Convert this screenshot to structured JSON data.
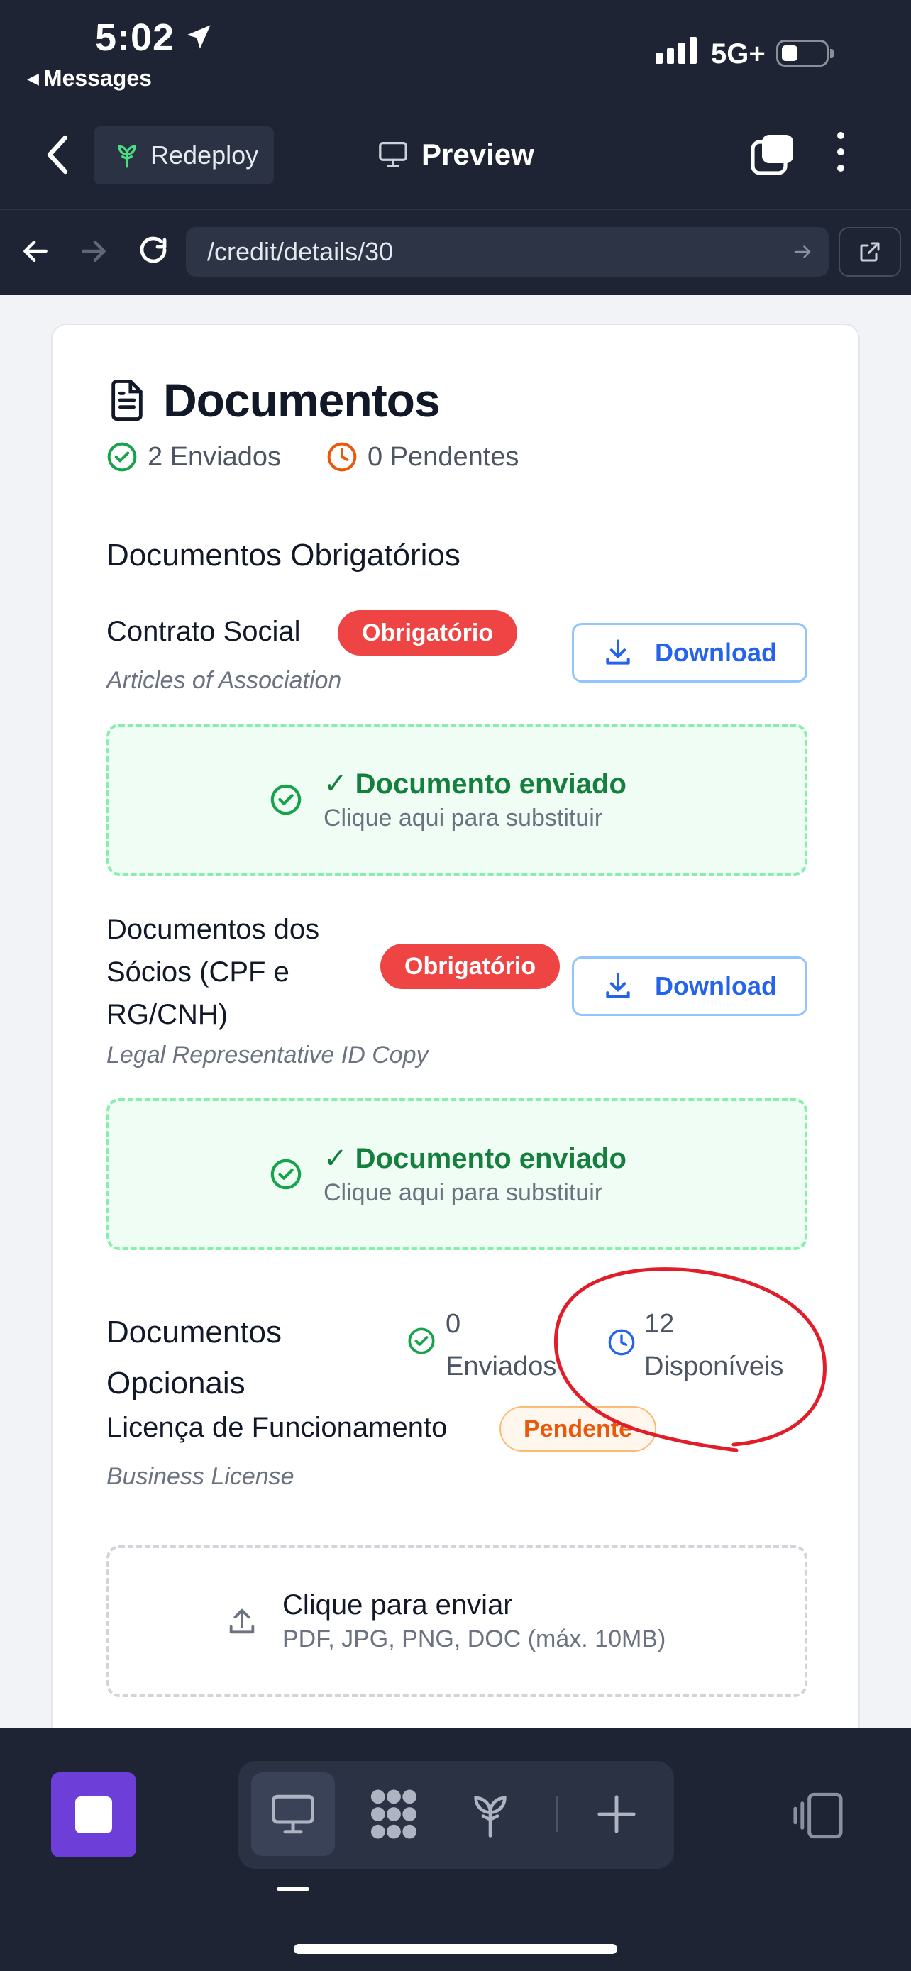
{
  "status_bar": {
    "time": "5:02",
    "back_app": "Messages",
    "network": "5G+"
  },
  "top_bar": {
    "redeploy_label": "Redeploy",
    "preview_label": "Preview"
  },
  "address_bar": {
    "url": "/credit/details/30"
  },
  "documents": {
    "title": "Documentos",
    "sent_count_label": "2 Enviados",
    "pending_count_label": "0 Pendentes",
    "required_section_title": "Documentos Obrigatórios",
    "required_items": [
      {
        "name": "Contrato Social",
        "subtitle": "Articles of Association",
        "badge": "Obrigatório",
        "download_label": "Download",
        "status_title": "✓ Documento enviado",
        "status_hint": "Clique aqui para substituir"
      },
      {
        "name_lines": [
          "Documentos dos",
          "Sócios (CPF e",
          "RG/CNH)"
        ],
        "subtitle": "Legal Representative ID Copy",
        "badge": "Obrigatório",
        "download_label": "Download",
        "status_title": "✓ Documento enviado",
        "status_hint": "Clique aqui para substituir"
      }
    ],
    "optional_section": {
      "title_lines": [
        "Documentos",
        "Opcionais"
      ],
      "sent_lines": [
        "0",
        "Enviados"
      ],
      "available_lines": [
        "12",
        "Disponíveis"
      ]
    },
    "optional_items": [
      {
        "name": "Licença de Funcionamento",
        "subtitle": "Business License",
        "badge": "Pendente",
        "upload_title": "Clique para enviar",
        "upload_hint": "PDF, JPG, PNG, DOC (máx. 10MB)"
      }
    ]
  },
  "colors": {
    "chrome": "#1e2433",
    "required_badge": "#ef4444",
    "pending_badge": "#ea580c",
    "success": "#16a34a",
    "link_blue": "#2563eb",
    "annotation_red": "#e11d2a",
    "stop_button": "#6d3fd8"
  },
  "icons": [
    "location-arrow-icon",
    "signal-icon",
    "battery-icon",
    "chevron-left-icon",
    "sprout-icon",
    "monitor-icon",
    "tabs-icon",
    "more-vertical-icon",
    "arrow-left-icon",
    "arrow-right-icon",
    "reload-icon",
    "external-link-icon",
    "document-icon",
    "check-circle-icon",
    "clock-icon",
    "download-icon",
    "upload-icon",
    "stop-icon",
    "grid-icon",
    "plus-icon",
    "devices-icon"
  ]
}
